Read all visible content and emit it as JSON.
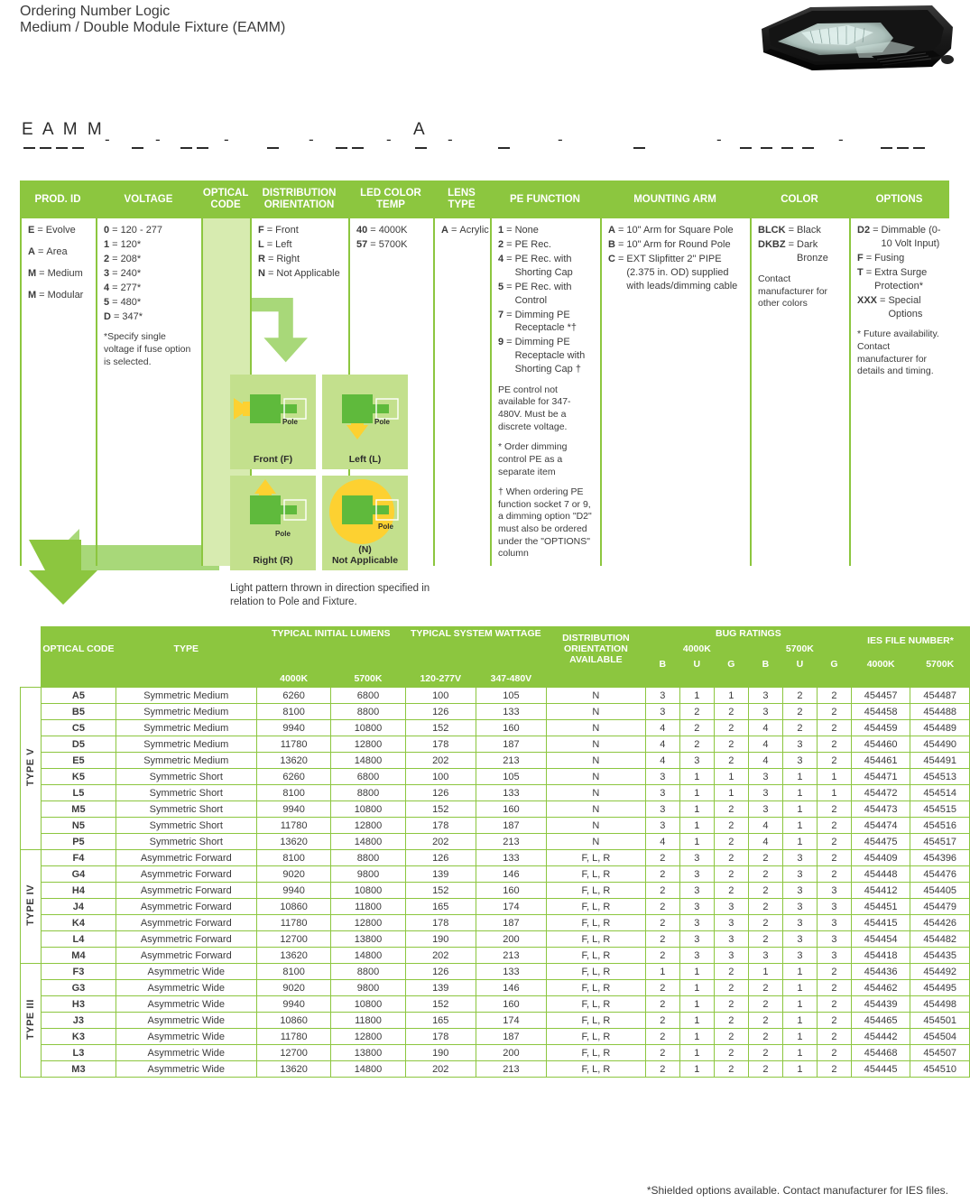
{
  "header": {
    "title": "Ordering Number Logic",
    "subtitle": "Medium / Double Module Fixture (EAMM)",
    "accent_color": "#7ac943"
  },
  "order_line": {
    "prefix": "E A M M",
    "fixed_letter": "A"
  },
  "legend": {
    "columns": [
      {
        "header": "PROD. ID",
        "items": [
          {
            "key": "E",
            "sep": "=",
            "value": "Evolve"
          },
          {
            "key": "A",
            "sep": "=",
            "value": "Area"
          },
          {
            "key": "M",
            "sep": "=",
            "value": "Medium"
          },
          {
            "key": "M",
            "sep": "=",
            "value": "Modular"
          }
        ]
      },
      {
        "header": "VOLTAGE",
        "items": [
          {
            "key": "0",
            "sep": "=",
            "value": "120 - 277"
          },
          {
            "key": "1",
            "sep": "=",
            "value": "120*"
          },
          {
            "key": "2",
            "sep": "=",
            "value": "208*"
          },
          {
            "key": "3",
            "sep": "=",
            "value": "240*"
          },
          {
            "key": "4",
            "sep": "=",
            "value": "277*"
          },
          {
            "key": "5",
            "sep": "=",
            "value": "480*"
          },
          {
            "key": "D",
            "sep": "=",
            "value": "347*"
          }
        ],
        "note": "*Specify single voltage if fuse option is selected."
      },
      {
        "header": "OPTICAL CODE",
        "items": []
      },
      {
        "header": "DISTRIBUTION ORIENTATION",
        "items": [
          {
            "key": "F",
            "sep": "=",
            "value": "Front"
          },
          {
            "key": "L",
            "sep": "=",
            "value": "Left"
          },
          {
            "key": "R",
            "sep": "=",
            "value": "Right"
          },
          {
            "key": "N",
            "sep": "=",
            "value": "Not Applicable"
          }
        ]
      },
      {
        "header": "LED COLOR TEMP",
        "items": [
          {
            "key": "40",
            "sep": "=",
            "value": "4000K"
          },
          {
            "key": "57",
            "sep": "=",
            "value": "5700K"
          }
        ]
      },
      {
        "header": "LENS TYPE",
        "items": [
          {
            "key": "A",
            "sep": "=",
            "value": "Acrylic"
          }
        ]
      },
      {
        "header": "PE FUNCTION",
        "items": [
          {
            "key": "1",
            "sep": "=",
            "value": "None"
          },
          {
            "key": "2",
            "sep": "=",
            "value": "PE Rec."
          },
          {
            "key": "4",
            "sep": "=",
            "value": "PE Rec. with Shorting Cap"
          },
          {
            "key": "5",
            "sep": "=",
            "value": "PE Rec. with Control"
          },
          {
            "key": "7",
            "sep": "=",
            "value": "Dimming PE Receptacle *†"
          },
          {
            "key": "9",
            "sep": "=",
            "value": "Dimming PE Receptacle with Shorting Cap †"
          }
        ],
        "notes": [
          "PE control not available for 347-480V. Must be a discrete voltage.",
          "* Order dimming control PE as a separate item",
          "† When ordering PE function socket 7 or 9, a dimming option \"D2\" must also be ordered under the \"OPTIONS\" column"
        ]
      },
      {
        "header": "MOUNTING ARM",
        "items": [
          {
            "key": "A",
            "sep": "=",
            "value": "10\" Arm for Square Pole"
          },
          {
            "key": "B",
            "sep": "=",
            "value": "10\" Arm for Round Pole"
          },
          {
            "key": "C",
            "sep": "=",
            "value": "EXT Slipfitter 2\" PIPE (2.375 in. OD) supplied with leads/dimming cable"
          }
        ]
      },
      {
        "header": "COLOR",
        "items": [
          {
            "key": "BLCK",
            "sep": "=",
            "value": "Black"
          },
          {
            "key": "DKBZ",
            "sep": "=",
            "value": "Dark Bronze"
          }
        ],
        "note": "Contact manufacturer for other colors"
      },
      {
        "header": "OPTIONS",
        "items": [
          {
            "key": "D2",
            "sep": "=",
            "value": "Dimmable (0-10 Volt Input)"
          },
          {
            "key": "F",
            "sep": "=",
            "value": "Fusing"
          },
          {
            "key": "T",
            "sep": "=",
            "value": "Extra Surge Protection*"
          },
          {
            "key": "XXX",
            "sep": "=",
            "value": "Special Options"
          }
        ],
        "note": "* Future availability. Contact manufacturer for details and timing."
      }
    ]
  },
  "orientation": {
    "cells": [
      {
        "label": "Front (F)",
        "pole_label": "Pole",
        "direction": "left"
      },
      {
        "label": "Left (L)",
        "pole_label": "Pole",
        "direction": "down"
      },
      {
        "label": "Right (R)",
        "pole_label": "Pole",
        "direction": "up"
      },
      {
        "label": "(N)\nNot Applicable",
        "pole_label": "Pole",
        "direction": "all"
      }
    ],
    "caption": "Light pattern thrown in direction specified in relation to Pole and Fixture."
  },
  "data_table": {
    "headers": {
      "optical_code": "OPTICAL CODE",
      "type": "TYPE",
      "typical_initial_lumens": "TYPICAL INITIAL LUMENS",
      "typical_system_wattage": "TYPICAL SYSTEM WATTAGE",
      "distribution_orientation_available": "DISTRIBUTION ORIENTATION AVAILABLE",
      "bug_ratings": "BUG RATINGS",
      "ies_file_number": "IES FILE NUMBER*",
      "sub": {
        "lumens_4000k": "4000K",
        "lumens_5700k": "5700K",
        "watt_120_277": "120-277V",
        "watt_347_480": "347-480V",
        "bug_4000k": "4000K",
        "bug_5700k": "5700K",
        "b": "B",
        "u": "U",
        "g": "G",
        "ies_4000k": "4000K",
        "ies_5700k": "5700K"
      }
    },
    "sections": [
      {
        "label": "TYPE V",
        "rows": [
          {
            "code": "A5",
            "type": "Symmetric Medium",
            "lm4000": "6260",
            "lm5700": "6800",
            "w120": "100",
            "w347": "105",
            "orient": "N",
            "b4": "3",
            "u4": "1",
            "g4": "1",
            "b5": "3",
            "u5": "2",
            "g5": "2",
            "ies4": "454457",
            "ies5": "454487"
          },
          {
            "code": "B5",
            "type": "Symmetric Medium",
            "lm4000": "8100",
            "lm5700": "8800",
            "w120": "126",
            "w347": "133",
            "orient": "N",
            "b4": "3",
            "u4": "2",
            "g4": "2",
            "b5": "3",
            "u5": "2",
            "g5": "2",
            "ies4": "454458",
            "ies5": "454488"
          },
          {
            "code": "C5",
            "type": "Symmetric Medium",
            "lm4000": "9940",
            "lm5700": "10800",
            "w120": "152",
            "w347": "160",
            "orient": "N",
            "b4": "4",
            "u4": "2",
            "g4": "2",
            "b5": "4",
            "u5": "2",
            "g5": "2",
            "ies4": "454459",
            "ies5": "454489"
          },
          {
            "code": "D5",
            "type": "Symmetric Medium",
            "lm4000": "11780",
            "lm5700": "12800",
            "w120": "178",
            "w347": "187",
            "orient": "N",
            "b4": "4",
            "u4": "2",
            "g4": "2",
            "b5": "4",
            "u5": "3",
            "g5": "2",
            "ies4": "454460",
            "ies5": "454490"
          },
          {
            "code": "E5",
            "type": "Symmetric Medium",
            "lm4000": "13620",
            "lm5700": "14800",
            "w120": "202",
            "w347": "213",
            "orient": "N",
            "b4": "4",
            "u4": "3",
            "g4": "2",
            "b5": "4",
            "u5": "3",
            "g5": "2",
            "ies4": "454461",
            "ies5": "454491"
          },
          {
            "code": "K5",
            "type": "Symmetric Short",
            "lm4000": "6260",
            "lm5700": "6800",
            "w120": "100",
            "w347": "105",
            "orient": "N",
            "b4": "3",
            "u4": "1",
            "g4": "1",
            "b5": "3",
            "u5": "1",
            "g5": "1",
            "ies4": "454471",
            "ies5": "454513"
          },
          {
            "code": "L5",
            "type": "Symmetric Short",
            "lm4000": "8100",
            "lm5700": "8800",
            "w120": "126",
            "w347": "133",
            "orient": "N",
            "b4": "3",
            "u4": "1",
            "g4": "1",
            "b5": "3",
            "u5": "1",
            "g5": "1",
            "ies4": "454472",
            "ies5": "454514"
          },
          {
            "code": "M5",
            "type": "Symmetric Short",
            "lm4000": "9940",
            "lm5700": "10800",
            "w120": "152",
            "w347": "160",
            "orient": "N",
            "b4": "3",
            "u4": "1",
            "g4": "2",
            "b5": "3",
            "u5": "1",
            "g5": "2",
            "ies4": "454473",
            "ies5": "454515"
          },
          {
            "code": "N5",
            "type": "Symmetric Short",
            "lm4000": "11780",
            "lm5700": "12800",
            "w120": "178",
            "w347": "187",
            "orient": "N",
            "b4": "3",
            "u4": "1",
            "g4": "2",
            "b5": "4",
            "u5": "1",
            "g5": "2",
            "ies4": "454474",
            "ies5": "454516"
          },
          {
            "code": "P5",
            "type": "Symmetric Short",
            "lm4000": "13620",
            "lm5700": "14800",
            "w120": "202",
            "w347": "213",
            "orient": "N",
            "b4": "4",
            "u4": "1",
            "g4": "2",
            "b5": "4",
            "u5": "1",
            "g5": "2",
            "ies4": "454475",
            "ies5": "454517"
          }
        ]
      },
      {
        "label": "TYPE IV",
        "rows": [
          {
            "code": "F4",
            "type": "Asymmetric Forward",
            "lm4000": "8100",
            "lm5700": "8800",
            "w120": "126",
            "w347": "133",
            "orient": "F, L, R",
            "b4": "2",
            "u4": "3",
            "g4": "2",
            "b5": "2",
            "u5": "3",
            "g5": "2",
            "ies4": "454409",
            "ies5": "454396"
          },
          {
            "code": "G4",
            "type": "Asymmetric Forward",
            "lm4000": "9020",
            "lm5700": "9800",
            "w120": "139",
            "w347": "146",
            "orient": "F, L, R",
            "b4": "2",
            "u4": "3",
            "g4": "2",
            "b5": "2",
            "u5": "3",
            "g5": "2",
            "ies4": "454448",
            "ies5": "454476"
          },
          {
            "code": "H4",
            "type": "Asymmetric Forward",
            "lm4000": "9940",
            "lm5700": "10800",
            "w120": "152",
            "w347": "160",
            "orient": "F, L, R",
            "b4": "2",
            "u4": "3",
            "g4": "2",
            "b5": "2",
            "u5": "3",
            "g5": "3",
            "ies4": "454412",
            "ies5": "454405"
          },
          {
            "code": "J4",
            "type": "Asymmetric Forward",
            "lm4000": "10860",
            "lm5700": "11800",
            "w120": "165",
            "w347": "174",
            "orient": "F, L, R",
            "b4": "2",
            "u4": "3",
            "g4": "3",
            "b5": "2",
            "u5": "3",
            "g5": "3",
            "ies4": "454451",
            "ies5": "454479"
          },
          {
            "code": "K4",
            "type": "Asymmetric Forward",
            "lm4000": "11780",
            "lm5700": "12800",
            "w120": "178",
            "w347": "187",
            "orient": "F, L, R",
            "b4": "2",
            "u4": "3",
            "g4": "3",
            "b5": "2",
            "u5": "3",
            "g5": "3",
            "ies4": "454415",
            "ies5": "454426"
          },
          {
            "code": "L4",
            "type": "Asymmetric Forward",
            "lm4000": "12700",
            "lm5700": "13800",
            "w120": "190",
            "w347": "200",
            "orient": "F, L, R",
            "b4": "2",
            "u4": "3",
            "g4": "3",
            "b5": "2",
            "u5": "3",
            "g5": "3",
            "ies4": "454454",
            "ies5": "454482"
          },
          {
            "code": "M4",
            "type": "Asymmetric Forward",
            "lm4000": "13620",
            "lm5700": "14800",
            "w120": "202",
            "w347": "213",
            "orient": "F, L, R",
            "b4": "2",
            "u4": "3",
            "g4": "3",
            "b5": "3",
            "u5": "3",
            "g5": "3",
            "ies4": "454418",
            "ies5": "454435"
          }
        ]
      },
      {
        "label": "TYPE III",
        "rows": [
          {
            "code": "F3",
            "type": "Asymmetric Wide",
            "lm4000": "8100",
            "lm5700": "8800",
            "w120": "126",
            "w347": "133",
            "orient": "F, L, R",
            "b4": "1",
            "u4": "1",
            "g4": "2",
            "b5": "1",
            "u5": "1",
            "g5": "2",
            "ies4": "454436",
            "ies5": "454492"
          },
          {
            "code": "G3",
            "type": "Asymmetric Wide",
            "lm4000": "9020",
            "lm5700": "9800",
            "w120": "139",
            "w347": "146",
            "orient": "F, L, R",
            "b4": "2",
            "u4": "1",
            "g4": "2",
            "b5": "2",
            "u5": "1",
            "g5": "2",
            "ies4": "454462",
            "ies5": "454495"
          },
          {
            "code": "H3",
            "type": "Asymmetric Wide",
            "lm4000": "9940",
            "lm5700": "10800",
            "w120": "152",
            "w347": "160",
            "orient": "F, L, R",
            "b4": "2",
            "u4": "1",
            "g4": "2",
            "b5": "2",
            "u5": "1",
            "g5": "2",
            "ies4": "454439",
            "ies5": "454498"
          },
          {
            "code": "J3",
            "type": "Asymmetric Wide",
            "lm4000": "10860",
            "lm5700": "11800",
            "w120": "165",
            "w347": "174",
            "orient": "F, L, R",
            "b4": "2",
            "u4": "1",
            "g4": "2",
            "b5": "2",
            "u5": "1",
            "g5": "2",
            "ies4": "454465",
            "ies5": "454501"
          },
          {
            "code": "K3",
            "type": "Asymmetric Wide",
            "lm4000": "11780",
            "lm5700": "12800",
            "w120": "178",
            "w347": "187",
            "orient": "F, L, R",
            "b4": "2",
            "u4": "1",
            "g4": "2",
            "b5": "2",
            "u5": "1",
            "g5": "2",
            "ies4": "454442",
            "ies5": "454504"
          },
          {
            "code": "L3",
            "type": "Asymmetric Wide",
            "lm4000": "12700",
            "lm5700": "13800",
            "w120": "190",
            "w347": "200",
            "orient": "F, L, R",
            "b4": "2",
            "u4": "1",
            "g4": "2",
            "b5": "2",
            "u5": "1",
            "g5": "2",
            "ies4": "454468",
            "ies5": "454507"
          },
          {
            "code": "M3",
            "type": "Asymmetric Wide",
            "lm4000": "13620",
            "lm5700": "14800",
            "w120": "202",
            "w347": "213",
            "orient": "F, L, R",
            "b4": "2",
            "u4": "1",
            "g4": "2",
            "b5": "2",
            "u5": "1",
            "g5": "2",
            "ies4": "454445",
            "ies5": "454510"
          }
        ]
      }
    ]
  },
  "footer_note": "*Shielded options available. Contact manufacturer for IES files."
}
